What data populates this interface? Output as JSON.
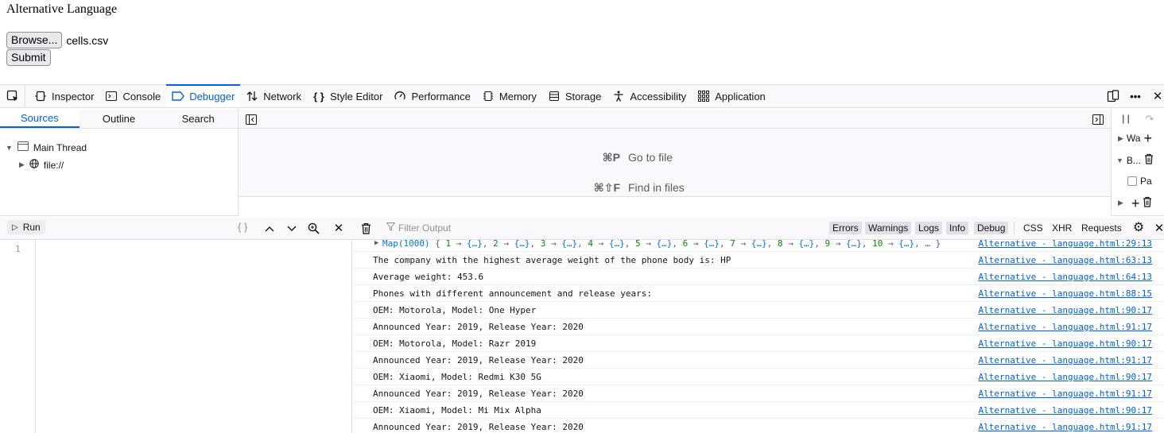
{
  "page": {
    "title": "Alternative Language",
    "browse_label": "Browse...",
    "file_name": "cells.csv",
    "submit_label": "Submit"
  },
  "devtools": {
    "tabs": [
      {
        "label": "Inspector",
        "icon": "inspector-icon"
      },
      {
        "label": "Console",
        "icon": "console-icon"
      },
      {
        "label": "Debugger",
        "icon": "debugger-icon",
        "active": true
      },
      {
        "label": "Network",
        "icon": "network-icon"
      },
      {
        "label": "Style Editor",
        "icon": "style-editor-icon"
      },
      {
        "label": "Performance",
        "icon": "performance-icon"
      },
      {
        "label": "Memory",
        "icon": "memory-icon"
      },
      {
        "label": "Storage",
        "icon": "storage-icon"
      },
      {
        "label": "Accessibility",
        "icon": "accessibility-icon"
      },
      {
        "label": "Application",
        "icon": "application-icon"
      }
    ]
  },
  "debugger": {
    "source_tabs": [
      "Sources",
      "Outline",
      "Search"
    ],
    "tree": {
      "thread": "Main Thread",
      "origin": "file://"
    },
    "shortcuts": [
      {
        "key": "⌘P",
        "label": "Go to file"
      },
      {
        "key": "⌘⇧F",
        "label": "Find in files"
      }
    ],
    "right_panel": {
      "watch": "Wa",
      "breakpoints": "B...",
      "pause": "Pa"
    }
  },
  "console": {
    "run_label": "Run",
    "filter_placeholder": "Filter Output",
    "levels": [
      "Errors",
      "Warnings",
      "Logs",
      "Info",
      "Debug"
    ],
    "types": [
      "CSS",
      "XHR",
      "Requests"
    ],
    "line_number": "1",
    "map_row": {
      "label": "Map(1000)",
      "summary": "{ 1 → {…}, 2 → {…}, 3 → {…}, 4 → {…}, 5 → {…}, 6 → {…}, 7 → {…}, 8 → {…}, 9 → {…}, 10 → {…}, … }",
      "source": "Alternative - language.html:29:13"
    },
    "logs": [
      {
        "message": "The company with the highest average weight of the phone body is: HP",
        "source": "Alternative - language.html:63:13"
      },
      {
        "message": "Average weight: 453.6",
        "source": "Alternative - language.html:64:13"
      },
      {
        "message": "Phones with different announcement and release years:",
        "source": "Alternative - language.html:88:15"
      },
      {
        "message": "OEM: Motorola, Model: One Hyper",
        "source": "Alternative - language.html:90:17"
      },
      {
        "message": "Announced Year: 2019, Release Year: 2020",
        "source": "Alternative - language.html:91:17"
      },
      {
        "message": "OEM: Motorola, Model: Razr 2019",
        "source": "Alternative - language.html:90:17"
      },
      {
        "message": "Announced Year: 2019, Release Year: 2020",
        "source": "Alternative - language.html:91:17"
      },
      {
        "message": "OEM: Xiaomi, Model: Redmi K30 5G",
        "source": "Alternative - language.html:90:17"
      },
      {
        "message": "Announced Year: 2019, Release Year: 2020",
        "source": "Alternative - language.html:91:17"
      },
      {
        "message": "OEM: Xiaomi, Model: Mi Mix Alpha",
        "source": "Alternative - language.html:90:17"
      },
      {
        "message": "Announced Year: 2019, Release Year: 2020",
        "source": "Alternative - language.html:91:17"
      }
    ]
  }
}
